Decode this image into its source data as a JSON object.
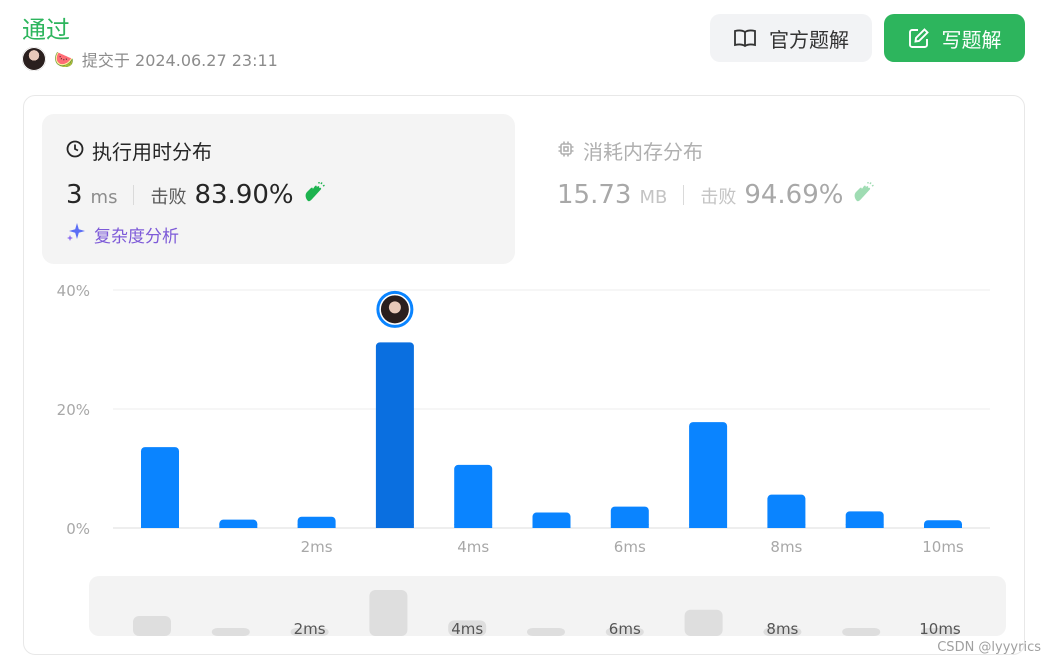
{
  "header": {
    "status": "通过",
    "submitted_label": "提交于 2024.06.27 23:11",
    "melon_emoji": "🍉"
  },
  "actions": {
    "official_solution_label": "官方题解",
    "write_solution_label": "写题解"
  },
  "runtime": {
    "title": "执行用时分布",
    "value": "3",
    "unit": "ms",
    "beat_label": "击败",
    "beat_value": "83.90%",
    "complexity_link": "复杂度分析"
  },
  "memory": {
    "title": "消耗内存分布",
    "value": "15.73",
    "unit": "MB",
    "beat_label": "击败",
    "beat_value": "94.69%"
  },
  "colors": {
    "accent_green": "#2db55d",
    "bar_blue": "#0a84ff",
    "bar_highlight": "#0a6fe0"
  },
  "chart_data": {
    "type": "bar",
    "title": "",
    "xlabel": "",
    "ylabel": "",
    "ylim": [
      0,
      40
    ],
    "y_ticks": [
      "0%",
      "20%",
      "40%"
    ],
    "x_tick_labels": [
      "2ms",
      "4ms",
      "6ms",
      "8ms",
      "10ms"
    ],
    "categories": [
      1,
      2,
      3,
      4,
      5,
      6,
      7,
      8,
      9,
      10,
      11
    ],
    "values": [
      13.6,
      1.4,
      1.9,
      31.2,
      10.6,
      2.6,
      3.6,
      17.8,
      5.6,
      2.8,
      1.3
    ],
    "highlight_index": 3,
    "grid": true
  },
  "watermark": "CSDN @lyyyrics"
}
